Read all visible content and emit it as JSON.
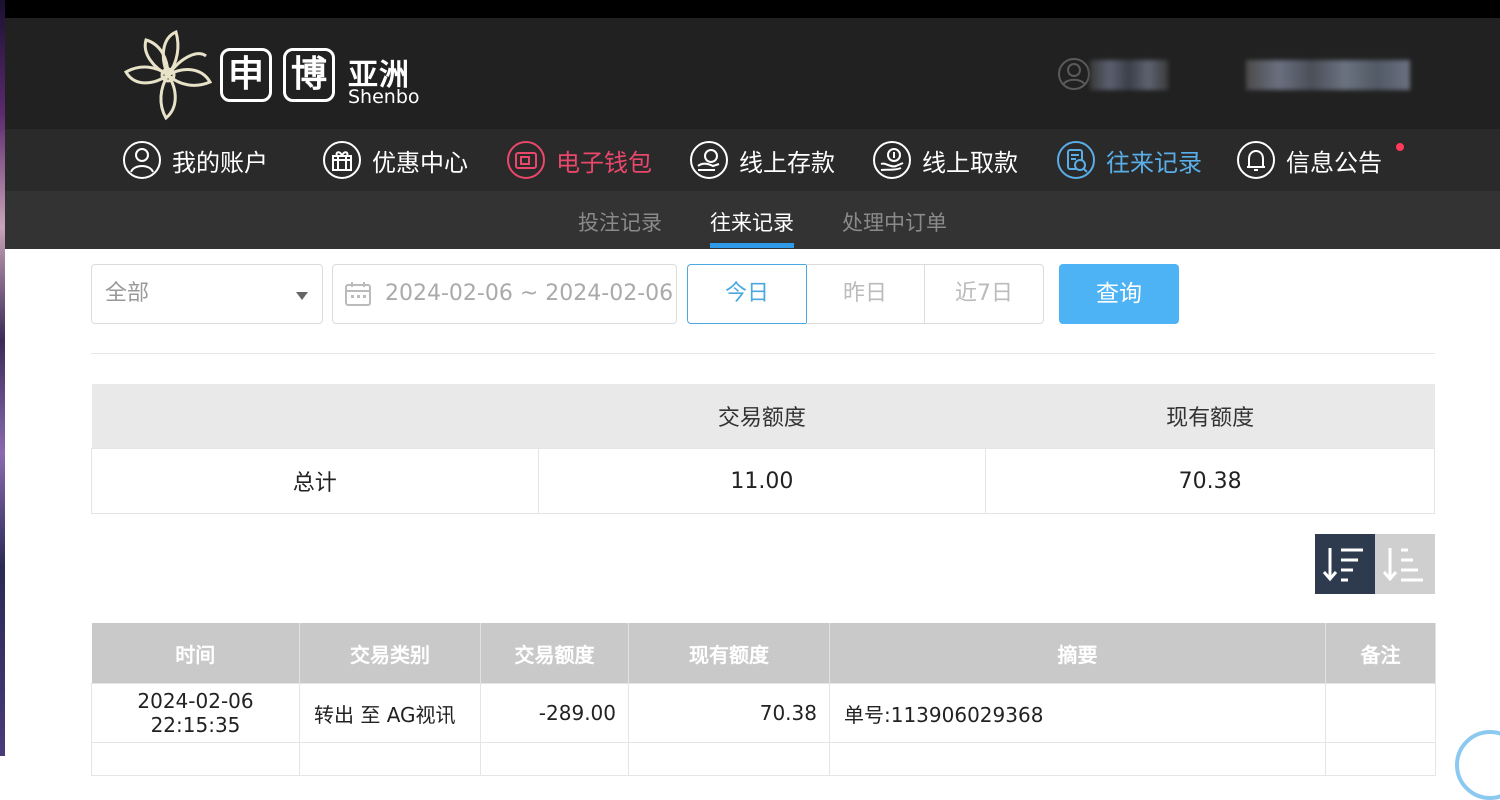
{
  "brand": {
    "logo_char1": "申",
    "logo_char2": "博",
    "logo_cn": "亚洲",
    "logo_en": "Shenbo"
  },
  "nav": {
    "items": [
      {
        "label": "我的账户",
        "icon": "user-icon"
      },
      {
        "label": "优惠中心",
        "icon": "gift-icon"
      },
      {
        "label": "电子钱包",
        "icon": "wallet-icon",
        "color": "#e9476b"
      },
      {
        "label": "线上存款",
        "icon": "deposit-icon"
      },
      {
        "label": "线上取款",
        "icon": "withdraw-icon"
      },
      {
        "label": "往来记录",
        "icon": "records-icon",
        "color": "#5aaee8"
      },
      {
        "label": "信息公告",
        "icon": "bell-icon"
      }
    ]
  },
  "subnav": {
    "items": [
      {
        "label": "投注记录"
      },
      {
        "label": "往来记录",
        "active": true
      },
      {
        "label": "处理中订单"
      }
    ]
  },
  "filter": {
    "type_selected": "全部",
    "date_range": "2024-02-06 ~ 2024-02-06",
    "quick_today": "今日",
    "quick_yesterday": "昨日",
    "quick_7days": "近7日",
    "query_label": "查询"
  },
  "summary": {
    "headers": [
      "",
      "交易额度",
      "现有额度"
    ],
    "row_label": "总计",
    "trade_amount": "11.00",
    "current_amount": "70.38"
  },
  "records": {
    "headers": [
      "时间",
      "交易类别",
      "交易额度",
      "现有额度",
      "摘要",
      "备注"
    ],
    "rows": [
      {
        "time": "2024-02-06 22:15:35",
        "type": "转出 至 AG视讯",
        "amount": "-289.00",
        "balance": "70.38",
        "summary": "单号:113906029368",
        "note": ""
      }
    ]
  },
  "colors": {
    "header_bg": "#212121",
    "accent_blue": "#4db3f5",
    "accent_pink": "#e9476b",
    "active_blue": "#5aaee8"
  }
}
